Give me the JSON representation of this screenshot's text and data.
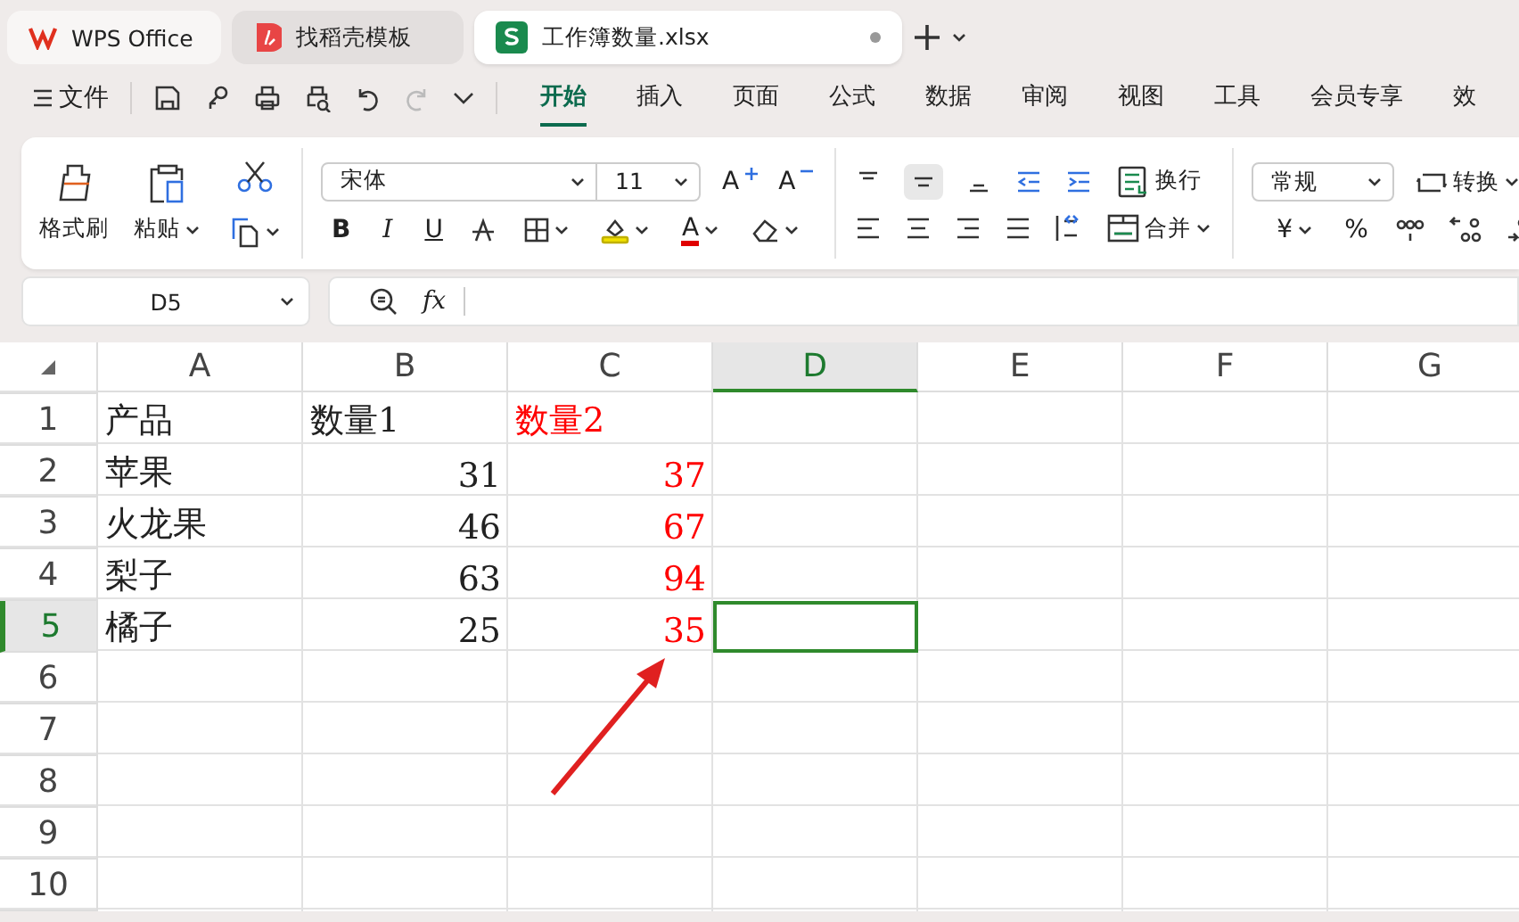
{
  "tabs": [
    {
      "label": "WPS Office",
      "kind": "home",
      "selected": false,
      "modified": false
    },
    {
      "label": "找稻壳模板",
      "kind": "template",
      "selected": false,
      "modified": false
    },
    {
      "label": "工作簿数量.xlsx",
      "kind": "sheet",
      "selected": true,
      "modified": true
    }
  ],
  "menu": {
    "file": "文件",
    "tabs": [
      {
        "label": "开始",
        "selected": true
      },
      {
        "label": "插入",
        "selected": false
      },
      {
        "label": "页面",
        "selected": false
      },
      {
        "label": "公式",
        "selected": false
      },
      {
        "label": "数据",
        "selected": false
      },
      {
        "label": "审阅",
        "selected": false
      },
      {
        "label": "视图",
        "selected": false
      },
      {
        "label": "工具",
        "selected": false
      },
      {
        "label": "会员专享",
        "selected": false
      },
      {
        "label": "效",
        "selected": false
      }
    ]
  },
  "ribbon": {
    "format_painter": "格式刷",
    "paste": "粘贴",
    "font_name": "宋体",
    "font_size": "11",
    "grow": "A",
    "shrink": "A",
    "bold": "B",
    "italic": "I",
    "underline": "U",
    "font_color": "A",
    "wrap": "换行",
    "merge": "合并",
    "number_format": "常规",
    "convert": "转换",
    "currency": "¥",
    "percent": "%"
  },
  "formula_bar": {
    "name_box": "D5",
    "fx": "fx"
  },
  "grid": {
    "columns": [
      {
        "label": "A",
        "selected": false
      },
      {
        "label": "B",
        "selected": false
      },
      {
        "label": "C",
        "selected": false
      },
      {
        "label": "D",
        "selected": true
      },
      {
        "label": "E",
        "selected": false
      },
      {
        "label": "F",
        "selected": false
      },
      {
        "label": "G",
        "selected": false
      }
    ],
    "rows": [
      {
        "label": "1",
        "selected": false,
        "cells": [
          {
            "text": "产品",
            "kind": "text"
          },
          {
            "text": "数量1",
            "kind": "text"
          },
          {
            "text": "数量2",
            "kind": "text",
            "color": "#ff0000"
          }
        ]
      },
      {
        "label": "2",
        "selected": false,
        "cells": [
          {
            "text": "苹果",
            "kind": "text"
          },
          {
            "text": "31",
            "kind": "number"
          },
          {
            "text": "37",
            "kind": "number",
            "color": "#ff0000"
          }
        ]
      },
      {
        "label": "3",
        "selected": false,
        "cells": [
          {
            "text": "火龙果",
            "kind": "text"
          },
          {
            "text": "46",
            "kind": "number"
          },
          {
            "text": "67",
            "kind": "number",
            "color": "#ff0000"
          }
        ]
      },
      {
        "label": "4",
        "selected": false,
        "cells": [
          {
            "text": "梨子",
            "kind": "text"
          },
          {
            "text": "63",
            "kind": "number"
          },
          {
            "text": "94",
            "kind": "number",
            "color": "#ff0000"
          }
        ]
      },
      {
        "label": "5",
        "selected": true,
        "cells": [
          {
            "text": "橘子",
            "kind": "text"
          },
          {
            "text": "25",
            "kind": "number"
          },
          {
            "text": "35",
            "kind": "number",
            "color": "#ff0000"
          }
        ]
      },
      {
        "label": "6",
        "selected": false,
        "cells": []
      },
      {
        "label": "7",
        "selected": false,
        "cells": []
      },
      {
        "label": "8",
        "selected": false,
        "cells": []
      },
      {
        "label": "9",
        "selected": false,
        "cells": []
      },
      {
        "label": "10",
        "selected": false,
        "cells": []
      }
    ]
  }
}
